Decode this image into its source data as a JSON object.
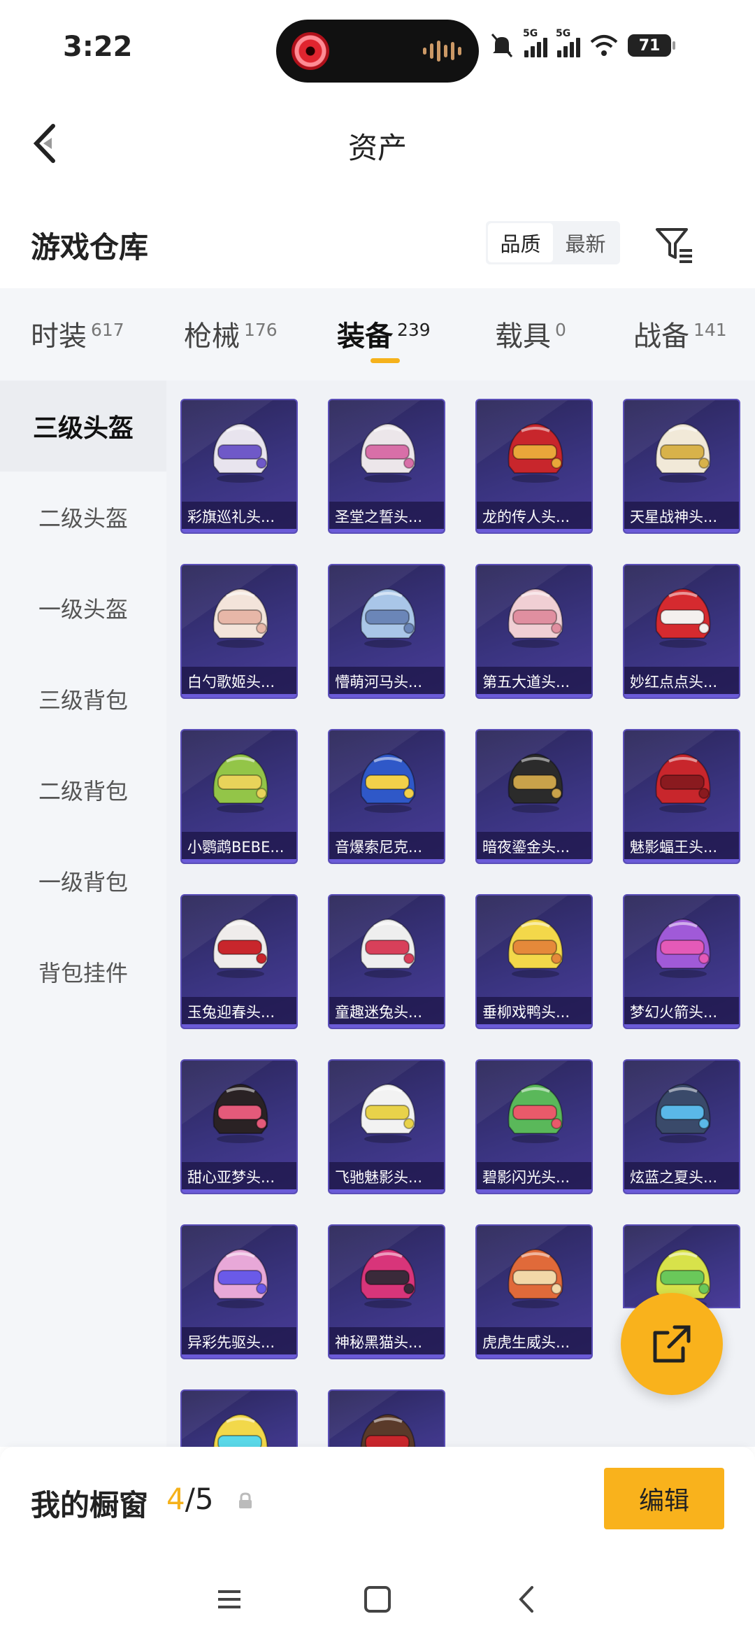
{
  "status_bar": {
    "time": "3:22",
    "network_1": "5G",
    "network_2": "5G",
    "battery": "71"
  },
  "header": {
    "title": "资产"
  },
  "warehouse": {
    "title": "游戏仓库",
    "sort_options": [
      "品质",
      "最新"
    ],
    "active_sort": "品质"
  },
  "tabs": [
    {
      "label": "时装",
      "count": "617"
    },
    {
      "label": "枪械",
      "count": "176"
    },
    {
      "label": "装备",
      "count": "239"
    },
    {
      "label": "载具",
      "count": "0"
    },
    {
      "label": "战备",
      "count": "141"
    }
  ],
  "active_tab": "装备",
  "sidebar": {
    "items": [
      "三级头盔",
      "二级头盔",
      "一级头盔",
      "三级背包",
      "二级背包",
      "一级背包",
      "背包挂件"
    ],
    "active": "三级头盔"
  },
  "items": [
    {
      "name": "彩旗巡礼头...",
      "color": "#e8e4ee",
      "accent": "#6f59c8"
    },
    {
      "name": "圣堂之誓头...",
      "color": "#ece6ea",
      "accent": "#d86fa8"
    },
    {
      "name": "龙的传人头...",
      "color": "#c8262c",
      "accent": "#e9a63a"
    },
    {
      "name": "天星战神头...",
      "color": "#f1e9d8",
      "accent": "#d8b24a"
    },
    {
      "name": "白勺歌姬头...",
      "color": "#f3e4da",
      "accent": "#e7b7a8"
    },
    {
      "name": "懵萌河马头...",
      "color": "#a9c6e8",
      "accent": "#6b86b8"
    },
    {
      "name": "第五大道头...",
      "color": "#f0cfd4",
      "accent": "#e08fa0"
    },
    {
      "name": "妙红点点头...",
      "color": "#d52a2f",
      "accent": "#f4f0ee"
    },
    {
      "name": "小鹦鹉BEBE...",
      "color": "#93c548",
      "accent": "#e8d35a"
    },
    {
      "name": "音爆索尼克...",
      "color": "#2f58c8",
      "accent": "#f2d04a"
    },
    {
      "name": "暗夜鎏金头...",
      "color": "#2b2b2b",
      "accent": "#c9a24a"
    },
    {
      "name": "魅影蝠王头...",
      "color": "#c8262c",
      "accent": "#8a1a1f"
    },
    {
      "name": "玉兔迎春头...",
      "color": "#efeceb",
      "accent": "#c8262c"
    },
    {
      "name": "童趣迷兔头...",
      "color": "#eeeeee",
      "accent": "#d8405a"
    },
    {
      "name": "垂柳戏鸭头...",
      "color": "#f3d84a",
      "accent": "#e5893a"
    },
    {
      "name": "梦幻火箭头...",
      "color": "#a05ad8",
      "accent": "#e45ab8"
    },
    {
      "name": "甜心亚梦头...",
      "color": "#2a2224",
      "accent": "#e45a7a"
    },
    {
      "name": "飞驰魅影头...",
      "color": "#f2f2f2",
      "accent": "#e8d24a"
    },
    {
      "name": "碧影闪光头...",
      "color": "#5ab85a",
      "accent": "#e85a6a"
    },
    {
      "name": "炫蓝之夏头...",
      "color": "#3a4a6a",
      "accent": "#5ab8e8"
    },
    {
      "name": "异彩先驱头...",
      "color": "#e8a8d8",
      "accent": "#6a5ae8"
    },
    {
      "name": "神秘黑猫头...",
      "color": "#d8357a",
      "accent": "#3a2a3a"
    },
    {
      "name": "虎虎生威头...",
      "color": "#e06a3a",
      "accent": "#f2d8a8"
    },
    {
      "name": "",
      "color": "#d8e24a",
      "accent": "#6ac85a"
    },
    {
      "name": "",
      "color": "#f2d84a",
      "accent": "#5ad8e8"
    },
    {
      "name": "",
      "color": "#5a3a2a",
      "accent": "#c8262c"
    }
  ],
  "showcase": {
    "label": "我的橱窗",
    "current": "4",
    "total": "/5",
    "edit_label": "编辑"
  },
  "colors": {
    "accent": "#f9b21c",
    "card_bg": "#3a3480"
  }
}
